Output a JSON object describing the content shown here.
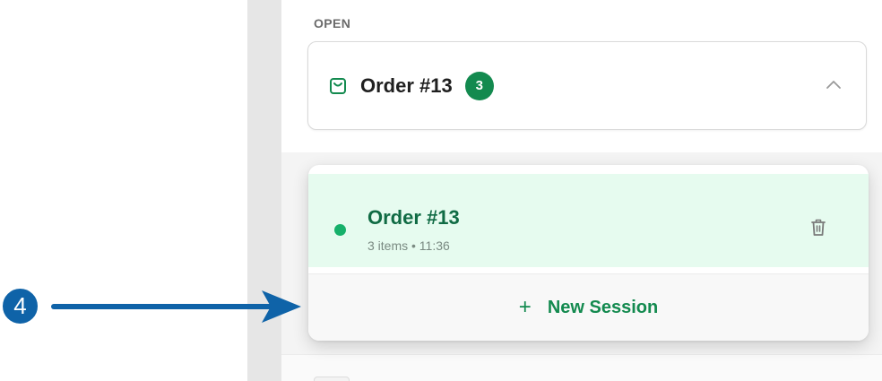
{
  "section_label": "OPEN",
  "order_header": {
    "title": "Order #13",
    "count": "3"
  },
  "session": {
    "title": "Order #13",
    "meta": "3 items • 11:36"
  },
  "new_session_label": "New Session",
  "callout_number": "4",
  "colors": {
    "accent_green": "#138a4f",
    "session_bg": "#e6fbef",
    "status_dot": "#16b06a",
    "callout_blue": "#0f63a8"
  },
  "icons": [
    "shopping-bag-icon",
    "chevron-up-icon",
    "status-dot-icon",
    "trash-icon",
    "plus-icon",
    "arrow-right-icon"
  ]
}
